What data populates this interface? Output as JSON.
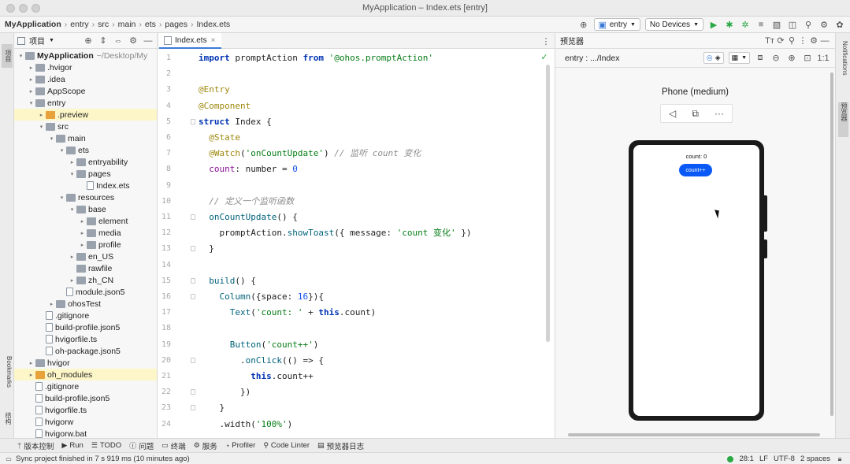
{
  "window": {
    "title": "MyApplication – Index.ets [entry]"
  },
  "breadcrumbs": [
    "MyApplication",
    "entry",
    "src",
    "main",
    "ets",
    "pages",
    "Index.ets"
  ],
  "toolbar": {
    "module_select": "entry",
    "device_select": "No Devices"
  },
  "left_strip": {
    "project_tab": "项目",
    "bookmarks_tab": "Bookmarks",
    "structure_tab": "结构"
  },
  "project_panel": {
    "title": "项目",
    "tree": [
      {
        "label": "MyApplication",
        "extra": "~/Desktop/My",
        "depth": 0,
        "arrow": "▾",
        "kind": "folder",
        "bold": true
      },
      {
        "label": ".hvigor",
        "depth": 1,
        "arrow": "▸",
        "kind": "folder"
      },
      {
        "label": ".idea",
        "depth": 1,
        "arrow": "▸",
        "kind": "folder"
      },
      {
        "label": "AppScope",
        "depth": 1,
        "arrow": "▸",
        "kind": "folder"
      },
      {
        "label": "entry",
        "depth": 1,
        "arrow": "▾",
        "kind": "folder"
      },
      {
        "label": ".preview",
        "depth": 2,
        "arrow": "▸",
        "kind": "folder-orange",
        "selected": true
      },
      {
        "label": "src",
        "depth": 2,
        "arrow": "▾",
        "kind": "folder"
      },
      {
        "label": "main",
        "depth": 3,
        "arrow": "▾",
        "kind": "folder"
      },
      {
        "label": "ets",
        "depth": 4,
        "arrow": "▾",
        "kind": "folder"
      },
      {
        "label": "entryability",
        "depth": 5,
        "arrow": "▸",
        "kind": "folder"
      },
      {
        "label": "pages",
        "depth": 5,
        "arrow": "▾",
        "kind": "folder"
      },
      {
        "label": "Index.ets",
        "depth": 6,
        "arrow": "",
        "kind": "file"
      },
      {
        "label": "resources",
        "depth": 4,
        "arrow": "▾",
        "kind": "folder"
      },
      {
        "label": "base",
        "depth": 5,
        "arrow": "▾",
        "kind": "folder"
      },
      {
        "label": "element",
        "depth": 6,
        "arrow": "▸",
        "kind": "folder"
      },
      {
        "label": "media",
        "depth": 6,
        "arrow": "▸",
        "kind": "folder"
      },
      {
        "label": "profile",
        "depth": 6,
        "arrow": "▸",
        "kind": "folder"
      },
      {
        "label": "en_US",
        "depth": 5,
        "arrow": "▸",
        "kind": "folder"
      },
      {
        "label": "rawfile",
        "depth": 5,
        "arrow": "",
        "kind": "folder"
      },
      {
        "label": "zh_CN",
        "depth": 5,
        "arrow": "▸",
        "kind": "folder"
      },
      {
        "label": "module.json5",
        "depth": 4,
        "arrow": "",
        "kind": "file"
      },
      {
        "label": "ohosTest",
        "depth": 3,
        "arrow": "▸",
        "kind": "folder"
      },
      {
        "label": ".gitignore",
        "depth": 2,
        "arrow": "",
        "kind": "file"
      },
      {
        "label": "build-profile.json5",
        "depth": 2,
        "arrow": "",
        "kind": "file"
      },
      {
        "label": "hvigorfile.ts",
        "depth": 2,
        "arrow": "",
        "kind": "file"
      },
      {
        "label": "oh-package.json5",
        "depth": 2,
        "arrow": "",
        "kind": "file"
      },
      {
        "label": "hvigor",
        "depth": 1,
        "arrow": "▸",
        "kind": "folder"
      },
      {
        "label": "oh_modules",
        "depth": 1,
        "arrow": "▸",
        "kind": "folder-orange",
        "selected": true
      },
      {
        "label": ".gitignore",
        "depth": 1,
        "arrow": "",
        "kind": "file"
      },
      {
        "label": "build-profile.json5",
        "depth": 1,
        "arrow": "",
        "kind": "file"
      },
      {
        "label": "hvigorfile.ts",
        "depth": 1,
        "arrow": "",
        "kind": "file"
      },
      {
        "label": "hvigorw",
        "depth": 1,
        "arrow": "",
        "kind": "file"
      },
      {
        "label": "hvigorw.bat",
        "depth": 1,
        "arrow": "",
        "kind": "file"
      }
    ]
  },
  "editor": {
    "tab_label": "Index.ets",
    "lines": [
      {
        "n": "1",
        "tokens": [
          [
            "kw",
            "import "
          ],
          [
            "",
            "promptAction "
          ],
          [
            "kw",
            "from "
          ],
          [
            "str",
            "'@ohos.promptAction'"
          ]
        ]
      },
      {
        "n": "2",
        "tokens": []
      },
      {
        "n": "3",
        "tokens": [
          [
            "ann",
            "@Entry"
          ]
        ]
      },
      {
        "n": "4",
        "tokens": [
          [
            "ann",
            "@Component"
          ]
        ]
      },
      {
        "n": "5",
        "tokens": [
          [
            "kw",
            "struct "
          ],
          [
            "",
            "Index {"
          ]
        ],
        "mark": true
      },
      {
        "n": "6",
        "tokens": [
          [
            "ann",
            "  @State"
          ]
        ]
      },
      {
        "n": "7",
        "tokens": [
          [
            "ann",
            "  @Watch"
          ],
          [
            "",
            "("
          ],
          [
            "str",
            "'onCountUpdate'"
          ],
          [
            "",
            ") "
          ],
          [
            "cm",
            "// 监听 count 变化"
          ]
        ]
      },
      {
        "n": "8",
        "tokens": [
          [
            "fld",
            "  count"
          ],
          [
            "",
            ": number = "
          ],
          [
            "num",
            "0"
          ]
        ]
      },
      {
        "n": "9",
        "tokens": []
      },
      {
        "n": "10",
        "tokens": [
          [
            "cm",
            "  // 定义一个监听函数"
          ]
        ]
      },
      {
        "n": "11",
        "tokens": [
          [
            "fn",
            "  onCountUpdate"
          ],
          [
            "",
            "() {"
          ]
        ],
        "mark": true
      },
      {
        "n": "12",
        "tokens": [
          [
            "",
            "    promptAction."
          ],
          [
            "fn",
            "showToast"
          ],
          [
            "",
            "({ message: "
          ],
          [
            "str",
            "'count 变化'"
          ],
          [
            "",
            " })"
          ]
        ]
      },
      {
        "n": "13",
        "tokens": [
          [
            "",
            "  }"
          ]
        ],
        "mark": true
      },
      {
        "n": "14",
        "tokens": []
      },
      {
        "n": "15",
        "tokens": [
          [
            "fn",
            "  build"
          ],
          [
            "",
            "() {"
          ]
        ],
        "mark": true
      },
      {
        "n": "16",
        "tokens": [
          [
            "fn",
            "    Column"
          ],
          [
            "",
            "({space: "
          ],
          [
            "num",
            "16"
          ],
          [
            "",
            "}){"
          ]
        ],
        "mark": true
      },
      {
        "n": "17",
        "tokens": [
          [
            "fn",
            "      Text"
          ],
          [
            "",
            "("
          ],
          [
            "str",
            "'count: '"
          ],
          [
            "",
            " + "
          ],
          [
            "kw",
            "this"
          ],
          [
            "",
            ".count)"
          ]
        ]
      },
      {
        "n": "18",
        "tokens": []
      },
      {
        "n": "19",
        "tokens": [
          [
            "fn",
            "      Button"
          ],
          [
            "",
            "("
          ],
          [
            "str",
            "'count++'"
          ],
          [
            "",
            ")"
          ]
        ]
      },
      {
        "n": "20",
        "tokens": [
          [
            "",
            "        ."
          ],
          [
            "fn",
            "onClick"
          ],
          [
            "",
            "(() => {"
          ]
        ],
        "mark": true
      },
      {
        "n": "21",
        "tokens": [
          [
            "kw",
            "          this"
          ],
          [
            "",
            ".count++"
          ]
        ]
      },
      {
        "n": "22",
        "tokens": [
          [
            "",
            "        })"
          ]
        ],
        "mark": true
      },
      {
        "n": "23",
        "tokens": [
          [
            "",
            "    }"
          ]
        ],
        "mark": true
      },
      {
        "n": "24",
        "tokens": [
          [
            "",
            "    .width("
          ],
          [
            "str",
            "'100%'"
          ],
          [
            "",
            ")"
          ]
        ]
      }
    ]
  },
  "preview": {
    "panel_title": "预览器",
    "route": "entry : .../Index",
    "device_name": "Phone (medium)",
    "app_text": "count: 0",
    "app_button": "count++"
  },
  "right_strip": {
    "notifications_tab": "Notifications",
    "preview_tab": "预览器"
  },
  "bottom_tools": [
    {
      "icon": "branch-icon",
      "glyph": "ᛘ",
      "label": "版本控制"
    },
    {
      "icon": "run-icon",
      "glyph": "▶",
      "label": "Run"
    },
    {
      "icon": "todo-icon",
      "glyph": "☰",
      "label": "TODO"
    },
    {
      "icon": "problems-icon",
      "glyph": "ⓘ",
      "label": "问题"
    },
    {
      "icon": "terminal-icon",
      "glyph": "▭",
      "label": "终端"
    },
    {
      "icon": "services-icon",
      "glyph": "⚙",
      "label": "服务"
    },
    {
      "icon": "profiler-icon",
      "glyph": "◔",
      "label": "Profiler"
    },
    {
      "icon": "code-linter-icon",
      "glyph": "⚲",
      "label": "Code Linter"
    },
    {
      "icon": "preview-log-icon",
      "glyph": "▤",
      "label": "预览器日志"
    }
  ],
  "status": {
    "message": "Sync project finished in 7 s 919 ms (10 minutes ago)",
    "position": "28:1",
    "line_ending": "LF",
    "encoding": "UTF-8",
    "indent": "2 spaces"
  },
  "colors": {
    "accent": "#3b7bd6",
    "run_green": "#2aa845",
    "app_button": "#0a59f7",
    "selection": "#fdf6c8"
  }
}
